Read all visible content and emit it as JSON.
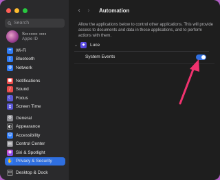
{
  "window": {
    "title": "Automation"
  },
  "sidebar": {
    "search_placeholder": "Search",
    "account": {
      "name": "S▪▪▪▪▪▪▪ ▪▪▪▪",
      "subtitle": "Apple ID"
    },
    "groups": [
      [
        {
          "label": "Wi-Fi",
          "icon": "wifi-icon",
          "color": "#2f7bf5",
          "glyph": "≈"
        },
        {
          "label": "Bluetooth",
          "icon": "bluetooth-icon",
          "color": "#2f7bf5",
          "glyph": "ᛒ"
        },
        {
          "label": "Network",
          "icon": "network-icon",
          "color": "#2f7bf5",
          "glyph": "◍"
        }
      ],
      [
        {
          "label": "Notifications",
          "icon": "notifications-icon",
          "color": "#eb4d4b",
          "glyph": "■"
        },
        {
          "label": "Sound",
          "icon": "sound-icon",
          "color": "#eb4d4b",
          "glyph": "♪"
        },
        {
          "label": "Focus",
          "icon": "focus-icon",
          "color": "#5b58d6",
          "glyph": "☾"
        },
        {
          "label": "Screen Time",
          "icon": "screen-time-icon",
          "color": "#5b58d6",
          "glyph": "⧗"
        }
      ],
      [
        {
          "label": "General",
          "icon": "gear-icon",
          "color": "#8e8e93",
          "glyph": "⚙"
        },
        {
          "label": "Appearance",
          "icon": "appearance-icon",
          "color": "#3a3a3c",
          "glyph": "◐"
        },
        {
          "label": "Accessibility",
          "icon": "accessibility-icon",
          "color": "#2f7bf5",
          "glyph": "☺"
        },
        {
          "label": "Control Center",
          "icon": "control-center-icon",
          "color": "#8e8e93",
          "glyph": "▤"
        },
        {
          "label": "Siri & Spotlight",
          "icon": "siri-icon",
          "color": "#c04fd6",
          "glyph": "◉"
        },
        {
          "label": "Privacy & Security",
          "icon": "privacy-hand-icon",
          "color": "#2f7bf5",
          "glyph": "✋",
          "active": true
        }
      ],
      [
        {
          "label": "Desktop & Dock",
          "icon": "desktop-dock-icon",
          "color": "#3a3a3c",
          "glyph": "▭"
        }
      ]
    ]
  },
  "main": {
    "back_label": "‹",
    "forward_label": "›",
    "title": "Automation",
    "description": "Allow the applications below to control other applications. This will provide access to documents and data in those applications, and to perform actions with them.",
    "app": {
      "name": "Luce",
      "expanded": true
    },
    "permission": {
      "label": "System Events",
      "enabled": true
    }
  },
  "colors": {
    "accent": "#2f6fe0",
    "annotation_arrow": "#f0326e"
  }
}
